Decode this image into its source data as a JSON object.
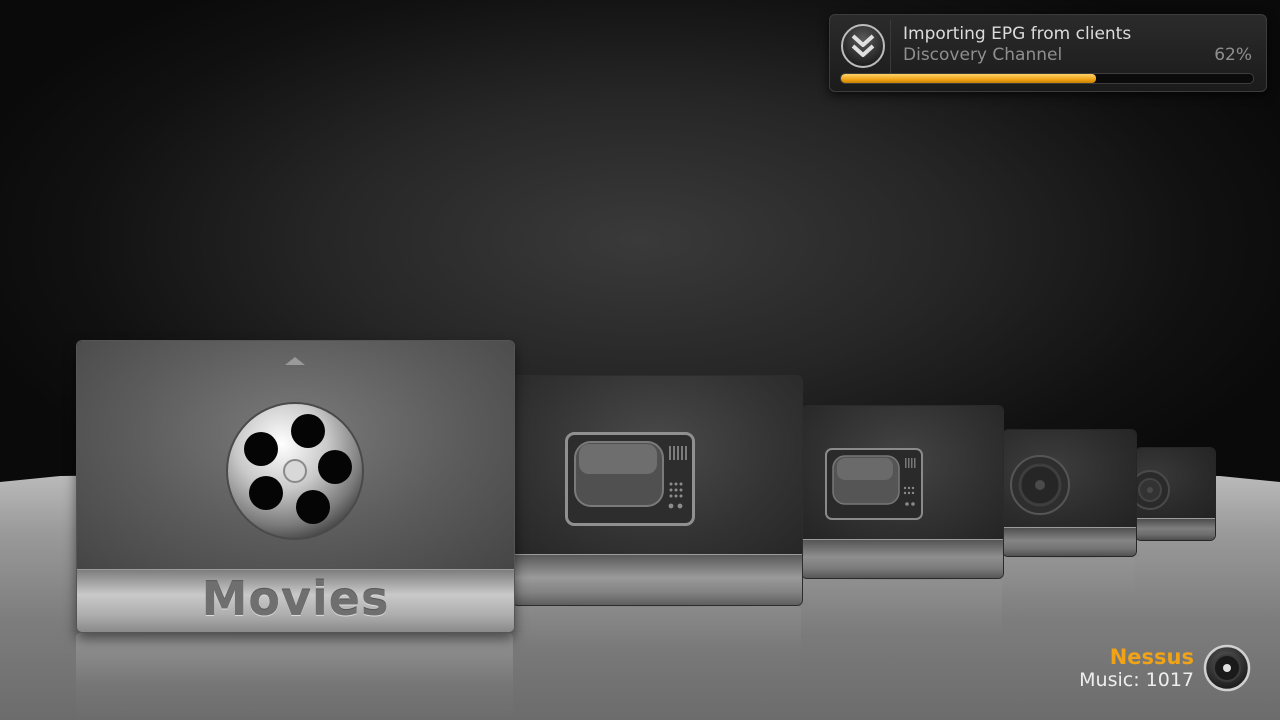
{
  "notification": {
    "title": "Importing EPG from clients",
    "subtitle": "Discovery Channel",
    "percent_label": "62%",
    "progress": 0.62,
    "icon": "double-chevron-down-icon",
    "accent_color": "#f0a317"
  },
  "home_menu": {
    "selected_label": "Movies",
    "items": [
      {
        "label": "Movies",
        "icon": "film-reel-icon",
        "selected": true
      },
      {
        "icon": "tv-icon"
      },
      {
        "icon": "tv-icon"
      },
      {
        "icon": "speaker-icon"
      },
      {
        "icon": "speaker-icon"
      }
    ]
  },
  "now_playing": {
    "name": "Nessus",
    "info": "Music: 1017",
    "icon": "speaker-icon",
    "name_color": "#f0a317"
  }
}
